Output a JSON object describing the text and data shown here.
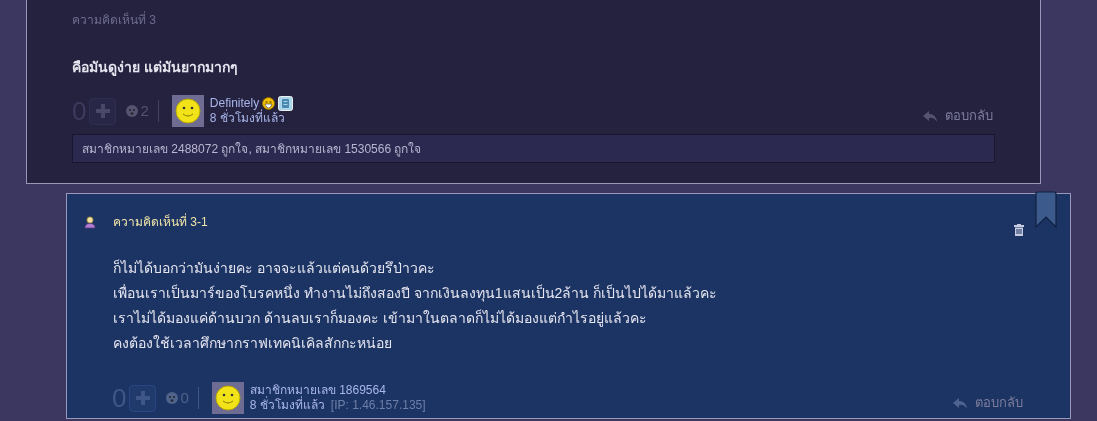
{
  "comment": {
    "label": "ความคิดเห็นที่ 3",
    "body": [
      "คือมันดูง่าย แต่มันยากมากๆ"
    ],
    "score": "0",
    "emotion_count": "2",
    "author": "Definitely",
    "time": "8 ชั่วโมงที่แล้ว",
    "reply_link": "ตอบกลับ",
    "likes": "สมาชิกหมายเลข 2488072 ถูกใจ, สมาชิกหมายเลข 1530566 ถูกใจ"
  },
  "reply": {
    "label": "ความคิดเห็นที่ 3-1",
    "body": [
      "ก็ไม่ได้บอกว่ามันง่ายคะ อาจจะแล้วแต่คนด้วยรึป่าวคะ",
      "เพื่อนเราเป็นมาร์ของโบรคหนึ่ง ทำงานไม่ถึงสองปี จากเงินลงทุน1แสนเป็น2ล้าน ก็เป็นไปได้มาแล้วคะ",
      "เราไม่ได้มองแค่ด้านบวก ด้านลบเราก็มองคะ เข้ามาในตลาดก็ไม่ได้มองแต่กำไรอยู่แล้วคะ",
      "คงต้องใช้เวลาศึกษากราฟเทคนิเคิลสักกะหน่อย"
    ],
    "score": "0",
    "emotion_count": "0",
    "author": "สมาชิกหมายเลข 1869564",
    "time": "8 ชั่วโมงที่แล้ว",
    "ip": "[IP: 1.46.157.135]",
    "reply_link": "ตอบกลับ"
  }
}
